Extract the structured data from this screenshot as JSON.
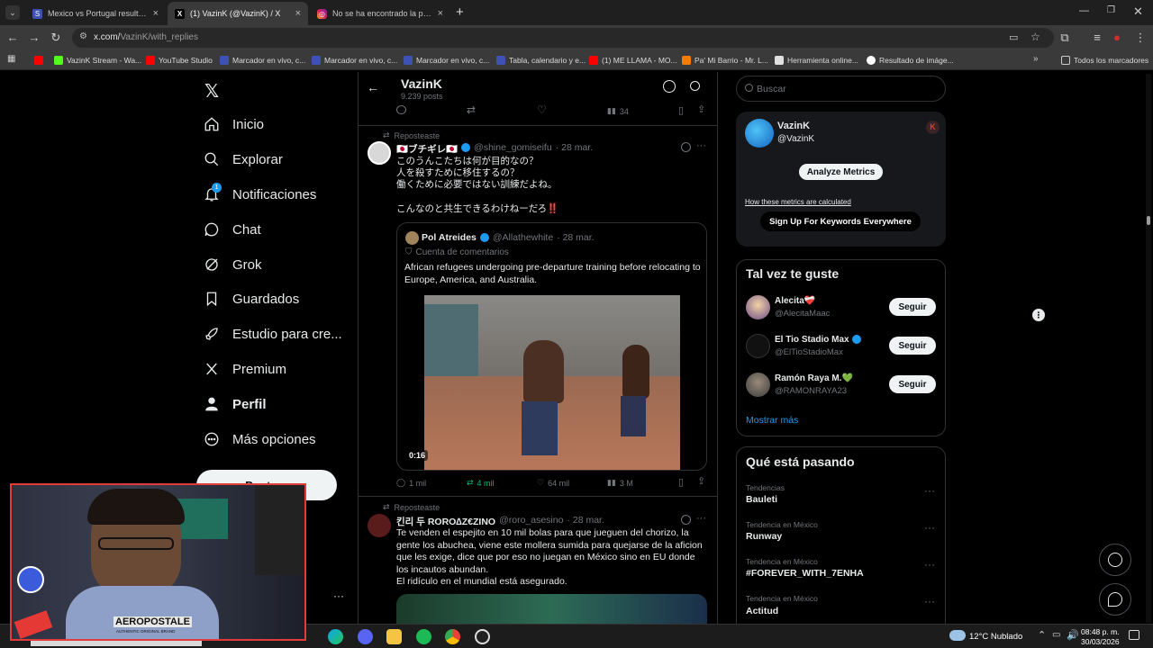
{
  "browser": {
    "tabs": [
      {
        "label": "Mexico vs Portugal resultados en",
        "active": false
      },
      {
        "label": "(1) VazinK (@VazinK) / X",
        "active": true
      },
      {
        "label": "No se ha encontrado la página",
        "active": false
      }
    ],
    "new_tab": "+",
    "url_host": "x.com/",
    "url_path": "VazinK/with_replies",
    "bookmarks": [
      "VazinK Stream - Wa...",
      "YouTube Studio",
      "Marcador en vivo, c...",
      "Marcador en vivo, c...",
      "Marcador en vivo, c...",
      "Tabla, calendario y e...",
      "(1) ME LLAMA - MO...",
      "Pa' Mi Barrio - Mr. L...",
      "Herramienta online...",
      "Resultado de imáge..."
    ],
    "bookmarks_folder": "Todos los marcadores"
  },
  "nav": {
    "items": [
      {
        "label": "Inicio",
        "icon": "home-icon"
      },
      {
        "label": "Explorar",
        "icon": "search-icon"
      },
      {
        "label": "Notificaciones",
        "icon": "bell-icon",
        "badge": "1"
      },
      {
        "label": "Chat",
        "icon": "chat-icon"
      },
      {
        "label": "Grok",
        "icon": "grok-icon"
      },
      {
        "label": "Guardados",
        "icon": "bookmark-icon"
      },
      {
        "label": "Estudio para cre...",
        "icon": "rocket-icon"
      },
      {
        "label": "Premium",
        "icon": "x-logo-icon"
      },
      {
        "label": "Perfil",
        "icon": "person-icon"
      },
      {
        "label": "Más opciones",
        "icon": "more-circle-icon"
      }
    ],
    "post_button": "Postear"
  },
  "header": {
    "title": "VazinK",
    "posts": "9.239 posts"
  },
  "prev_actions": {
    "views": "34"
  },
  "post1": {
    "repost_label": "Reposteaste",
    "author": "🇯🇵ブチギレ🇯🇵",
    "handle": "@shine_gomiseifu",
    "date": "· 28 mar.",
    "lines": [
      "このうんこたちは何が目的なの？",
      "人を殺すために移住するの？",
      "働くために必要ではない訓練だよね。",
      "こんなのと共生できるわけねーだろ‼️"
    ],
    "quote": {
      "author": "Pol Atreides",
      "handle": "@Allathewhite",
      "date": "· 28 mar.",
      "context": "Cuenta de comentarios",
      "text": "African refugees undergoing pre-departure training before relocating to Europe, America, and Australia.",
      "video_time": "0:16"
    },
    "replies": "1 mil",
    "reposts": "4 mil",
    "likes": "64 mil",
    "views": "3 M"
  },
  "post2": {
    "repost_label": "Reposteaste",
    "author": "킨리 두 RORO∆Z€ZINO",
    "handle": "@roro_asesino",
    "date": "· 28 mar.",
    "text": "Te venden el espejito en 10 mil bolas para que jueguen del chorizo, la gente los abuchea, viene este mollera sumida para quejarse de la aficion que les exige, dice que por eso no juegan en México sino en EU donde los incautos abundan.",
    "text2": "El ridículo en el mundial está asegurado."
  },
  "right": {
    "search_placeholder": "Buscar",
    "metrics": {
      "name": "VazinK",
      "handle": "@VazinK",
      "badge": "K",
      "analyze": "Analyze Metrics",
      "how_link": "How these metrics are calculated",
      "signup": "Sign Up For Keywords Everywhere"
    },
    "suggest_title": "Tal vez te guste",
    "suggestions": [
      {
        "name": "Alecita❤️‍🩹",
        "handle": "@AlecitaMaac",
        "button": "Seguir"
      },
      {
        "name": "El Tio Stadio Max",
        "handle": "@ElTioStadioMax",
        "button": "Seguir"
      },
      {
        "name": "Ramón Raya M.💚",
        "handle": "@RAMONRAYA23",
        "button": "Seguir"
      }
    ],
    "show_more": "Mostrar más",
    "trends_title": "Qué está pasando",
    "trends": [
      {
        "label": "Tendencias",
        "name": "Bauleti"
      },
      {
        "label": "Tendencia en México",
        "name": "Runway"
      },
      {
        "label": "Tendencia en México",
        "name": "#FOREVER_WITH_7ENHA"
      },
      {
        "label": "Tendencia en México",
        "name": "Actitud"
      }
    ]
  },
  "taskbar": {
    "weather": "12°C  Nublado",
    "time": "08:48 p. m.",
    "date": "30/03/2026"
  },
  "webcam": {
    "shirt_text": "AEROPOSTALE",
    "shirt_sub": "AUTHENTIC ORIGINAL BRAND"
  },
  "colors": {
    "bg": "#000000",
    "blue": "#1d9bf0",
    "green": "#00ba7c",
    "border": "#2f3336",
    "muted": "#71767b"
  }
}
